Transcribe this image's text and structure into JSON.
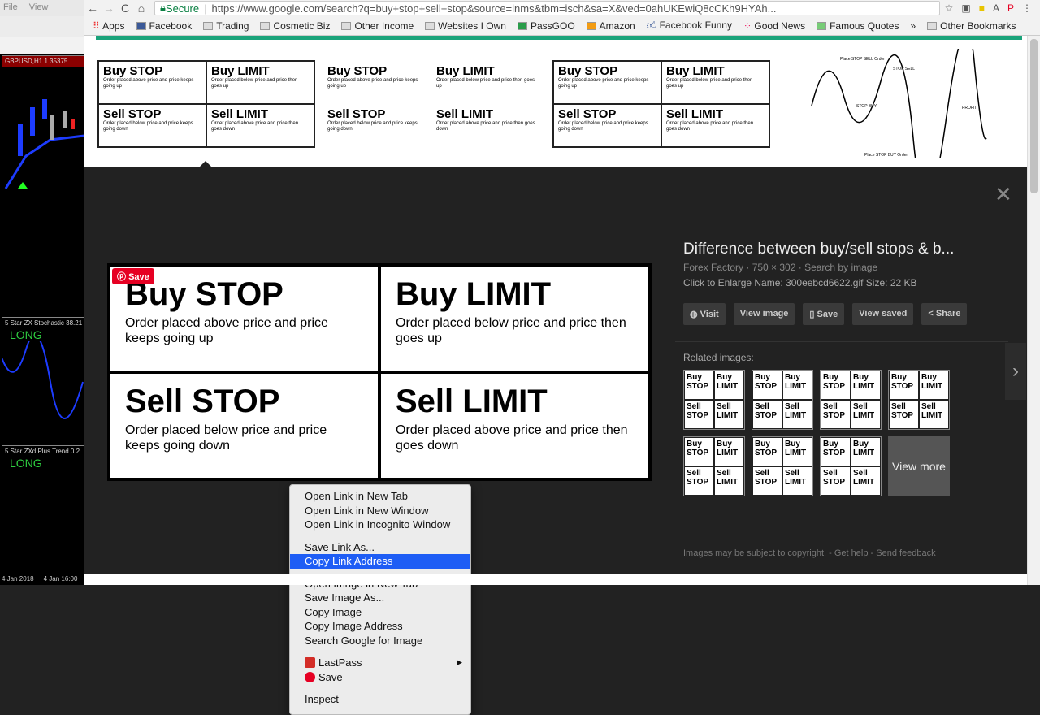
{
  "mt4": {
    "menu": [
      "File",
      "View"
    ],
    "symbol": "GBPUSD,H1  1.35375",
    "ind1": "5 Star ZX Stochastic 38.21",
    "ind2": "5 Star ZXd Plus Trend 0.2",
    "long": "LONG",
    "dates": [
      "4 Jan 2018",
      "4 Jan 16:00"
    ]
  },
  "browser": {
    "secure": "Secure",
    "url": "https://www.google.com/search?q=buy+stop+sell+stop&source=lnms&tbm=isch&sa=X&ved=0ahUKEwiQ8cCKh9HYAh...",
    "bookmarks": [
      "Apps",
      "Facebook",
      "Trading",
      "Cosmetic Biz",
      "Other Income",
      "Websites I Own",
      "PassGOO",
      "Amazon",
      "Facebook Funny",
      "Good News",
      "Famous Quotes",
      "»",
      "Other Bookmarks"
    ]
  },
  "cards": {
    "buy_stop": "Buy STOP",
    "buy_limit": "Buy LIMIT",
    "sell_stop": "Sell STOP",
    "sell_limit": "Sell LIMIT",
    "buy_stop_desc": "Order placed above price and price keeps going up",
    "buy_limit_desc": "Order placed below price and price then goes up",
    "sell_stop_desc": "Order placed below price and price keeps going down",
    "sell_limit_desc": "Order placed above price and price then goes down"
  },
  "chart_thumb": {
    "labels": [
      "Place STOP SELL Order",
      "STOP SELL",
      "PROFIT",
      "STOP BUY",
      "Place STOP BUY Order"
    ]
  },
  "viewer": {
    "pin_save": "Save",
    "title": "Difference between buy/sell stops & b...",
    "source": "Forex Factory",
    "dims": "750 × 302",
    "search_by_image": "Search by image",
    "meta": "Click to Enlarge Name: 300eebcd6622.gif Size: 22 KB",
    "buttons": [
      "Visit",
      "View image",
      "Save",
      "View saved",
      "Share"
    ],
    "related": "Related images:",
    "view_more": "View more",
    "footer": {
      "copyright": "Images may be subject to copyright.",
      "help": "Get help",
      "feedback": "Send feedback"
    }
  },
  "context_menu": {
    "items": [
      "Open Link in New Tab",
      "Open Link in New Window",
      "Open Link in Incognito Window",
      "Save Link As...",
      "Copy Link Address",
      "Open Image in New Tab",
      "Save Image As...",
      "Copy Image",
      "Copy Image Address",
      "Search Google for Image",
      "LastPass",
      "Save",
      "Inspect"
    ],
    "highlighted": "Copy Link Address"
  },
  "colors": {
    "highlight": "#1e5df5",
    "pinterest": "#e60023",
    "lastpass": "#d32d27",
    "secure": "#0b8043"
  }
}
